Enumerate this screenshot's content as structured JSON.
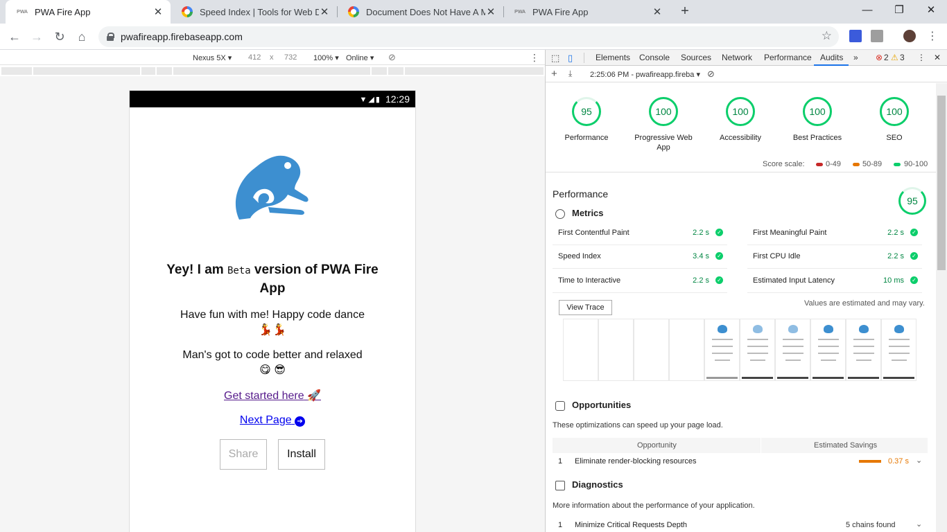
{
  "browser": {
    "tabs": [
      {
        "title": "PWA Fire App",
        "favicon": "pwa-favicon"
      },
      {
        "title": "Speed Index | Tools for Web De",
        "favicon": "google-favicon"
      },
      {
        "title": "Document Does Not Have A Met",
        "favicon": "google-favicon"
      },
      {
        "title": "PWA Fire App",
        "favicon": "pwa-favicon"
      }
    ],
    "url": "pwafireapp.firebaseapp.com",
    "pwa_favicon_text": "PWA"
  },
  "device_toolbar": {
    "device": "Nexus 5X ▾",
    "width": "412",
    "times": "x",
    "height": "732",
    "zoom": "100% ▾",
    "network": "Online ▾"
  },
  "app": {
    "status_time": "12:29",
    "heading_pre": "Yey! I am ",
    "heading_beta": "Beta",
    "heading_post": " version of PWA Fire App",
    "line1": "Have fun with me! Happy code dance",
    "line1_emoji": "💃💃",
    "line2": "Man's got to code better and relaxed",
    "line2_emoji": "😋 😎",
    "link_started": "Get started here",
    "link_started_icon": "🚀",
    "link_next": "Next Page",
    "link_next_icon": "➔",
    "btn_share": "Share",
    "btn_install": "Install"
  },
  "devtools": {
    "tabs": [
      "Elements",
      "Console",
      "Sources",
      "Network",
      "Performance",
      "Audits"
    ],
    "more": "»",
    "errors": "2",
    "warnings": "3",
    "report_label": "2:25:06 PM - pwafireapp.fireba ▾",
    "scores": [
      {
        "label": "Performance",
        "value": "95"
      },
      {
        "label": "Progressive Web App",
        "value": "100"
      },
      {
        "label": "Accessibility",
        "value": "100"
      },
      {
        "label": "Best Practices",
        "value": "100"
      },
      {
        "label": "SEO",
        "value": "100"
      }
    ],
    "score_scale_label": "Score scale:",
    "scale": [
      "0-49",
      "50-89",
      "90-100"
    ],
    "colors": {
      "fail": "#c62828",
      "average": "#e67700",
      "pass": "#0cce6b"
    },
    "performance_title": "Performance",
    "performance_score": "95",
    "metrics_title": "Metrics",
    "metrics": [
      {
        "name": "First Contentful Paint",
        "value": "2.2 s"
      },
      {
        "name": "First Meaningful Paint",
        "value": "2.2 s"
      },
      {
        "name": "Speed Index",
        "value": "3.4 s"
      },
      {
        "name": "First CPU Idle",
        "value": "2.2 s"
      },
      {
        "name": "Time to Interactive",
        "value": "2.2 s"
      },
      {
        "name": "Estimated Input Latency",
        "value": "10 ms"
      }
    ],
    "view_trace": "View Trace",
    "estimated_note": "Values are estimated and may vary.",
    "opportunities_title": "Opportunities",
    "opportunities_desc": "These optimizations can speed up your page load.",
    "opp_col1": "Opportunity",
    "opp_col2": "Estimated Savings",
    "opportunity": {
      "index": "1",
      "name": "Eliminate render-blocking resources",
      "savings": "0.37 s"
    },
    "diagnostics_title": "Diagnostics",
    "diagnostics_desc": "More information about the performance of your application.",
    "diagnostic": {
      "index": "1",
      "name": "Minimize Critical Requests Depth",
      "value": "5 chains found"
    }
  }
}
